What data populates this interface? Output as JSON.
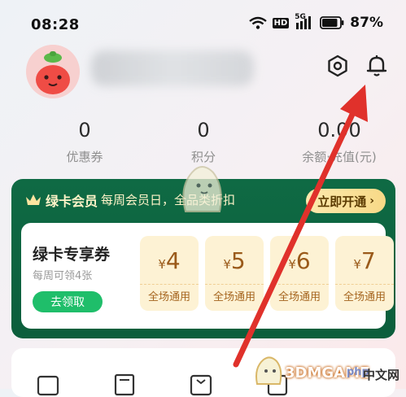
{
  "status_bar": {
    "time": "08:28",
    "hd_label": "HD",
    "network_label": "5G",
    "battery": "87%",
    "icons": [
      "wifi-icon",
      "hd-icon",
      "signal-5g-icon",
      "battery-icon"
    ]
  },
  "header": {
    "avatar_icon": "radish-avatar",
    "settings_icon": "settings-icon",
    "notification_icon": "bell-icon"
  },
  "stats": [
    {
      "value": "0",
      "label": "优惠券"
    },
    {
      "value": "0",
      "label": "积分"
    },
    {
      "value": "0.00",
      "label": "余额·充值(元)"
    }
  ],
  "member_card": {
    "crown_icon": "crown-icon",
    "title": "绿卡会员",
    "promo": "每周会员日，全品类折扣",
    "open_button": "立即开通",
    "coupons_title": "绿卡专享券",
    "coupons_subtitle": "每周可领4张",
    "claim_button": "去领取",
    "coupons": [
      {
        "currency": "¥",
        "amount": "4",
        "label": "全场通用"
      },
      {
        "currency": "¥",
        "amount": "5",
        "label": "全场通用"
      },
      {
        "currency": "¥",
        "amount": "6",
        "label": "全场通用"
      },
      {
        "currency": "¥",
        "amount": "7",
        "label": "全场通用"
      }
    ],
    "colors": {
      "card": "#0f6a44",
      "claim": "#1fbe6a",
      "coupon_bg": "#fdf2d4"
    }
  },
  "watermark": {
    "text": "3DMGAME",
    "php": "php",
    "cn": "中文网"
  },
  "annotation": {
    "arrow_color": "#e0312b"
  }
}
